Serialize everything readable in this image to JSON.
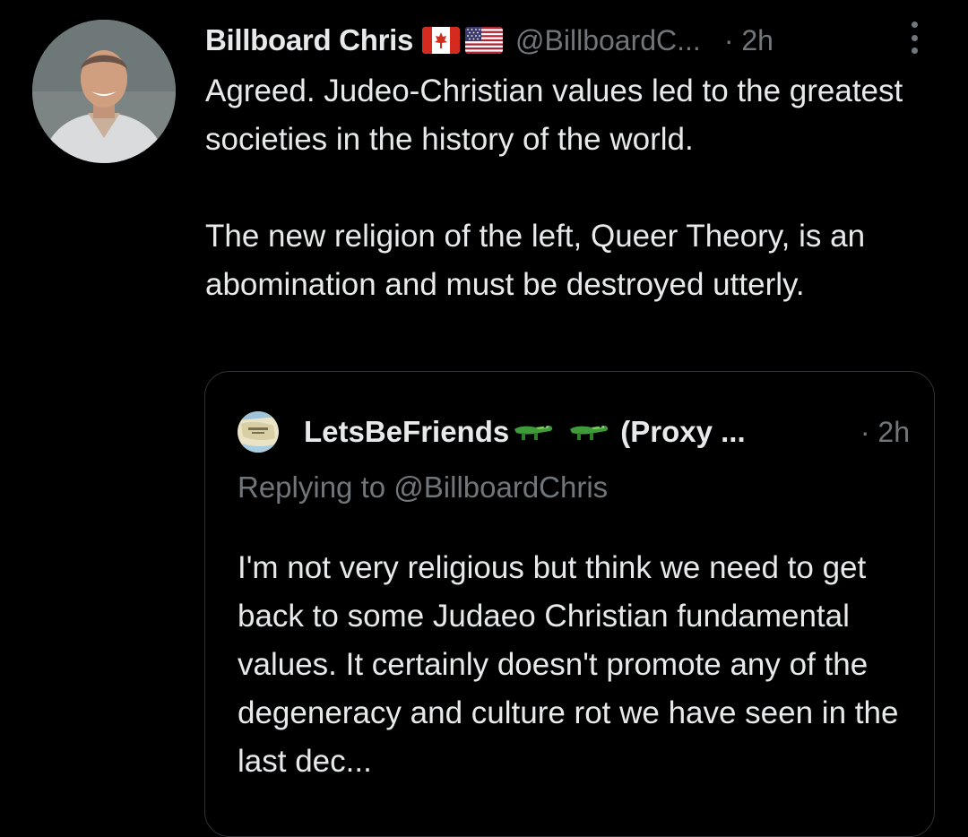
{
  "tweet": {
    "display_name": "Billboard Chris",
    "flags": [
      "canada-flag-icon",
      "usa-flag-icon"
    ],
    "handle": "@BillboardC...",
    "timestamp": "· 2h",
    "more_icon": "vertical-ellipsis-icon",
    "text": "Agreed. Judeo-Christian values led to the greatest societies in the history of the world.\n\nThe new religion of the left, Queer Theory, is an abomination and must be destroyed utterly."
  },
  "quoted_tweet": {
    "display_name": "LetsBeFriends",
    "name_emoji": [
      "crocodile-icon",
      "crocodile-icon"
    ],
    "display_name_suffix": "(Proxy ...",
    "timestamp": "· 2h",
    "replying_to": "Replying to @BillboardChris",
    "text": "I'm not very religious but think we need to get back to some Judaeo Christian fundamental values.  It certainly doesn't promote any of the degeneracy and culture rot we have seen in the last dec..."
  },
  "colors": {
    "background": "#000000",
    "primary_text": "#e7e9ea",
    "secondary_text": "#71767b",
    "border": "#2f3336"
  }
}
